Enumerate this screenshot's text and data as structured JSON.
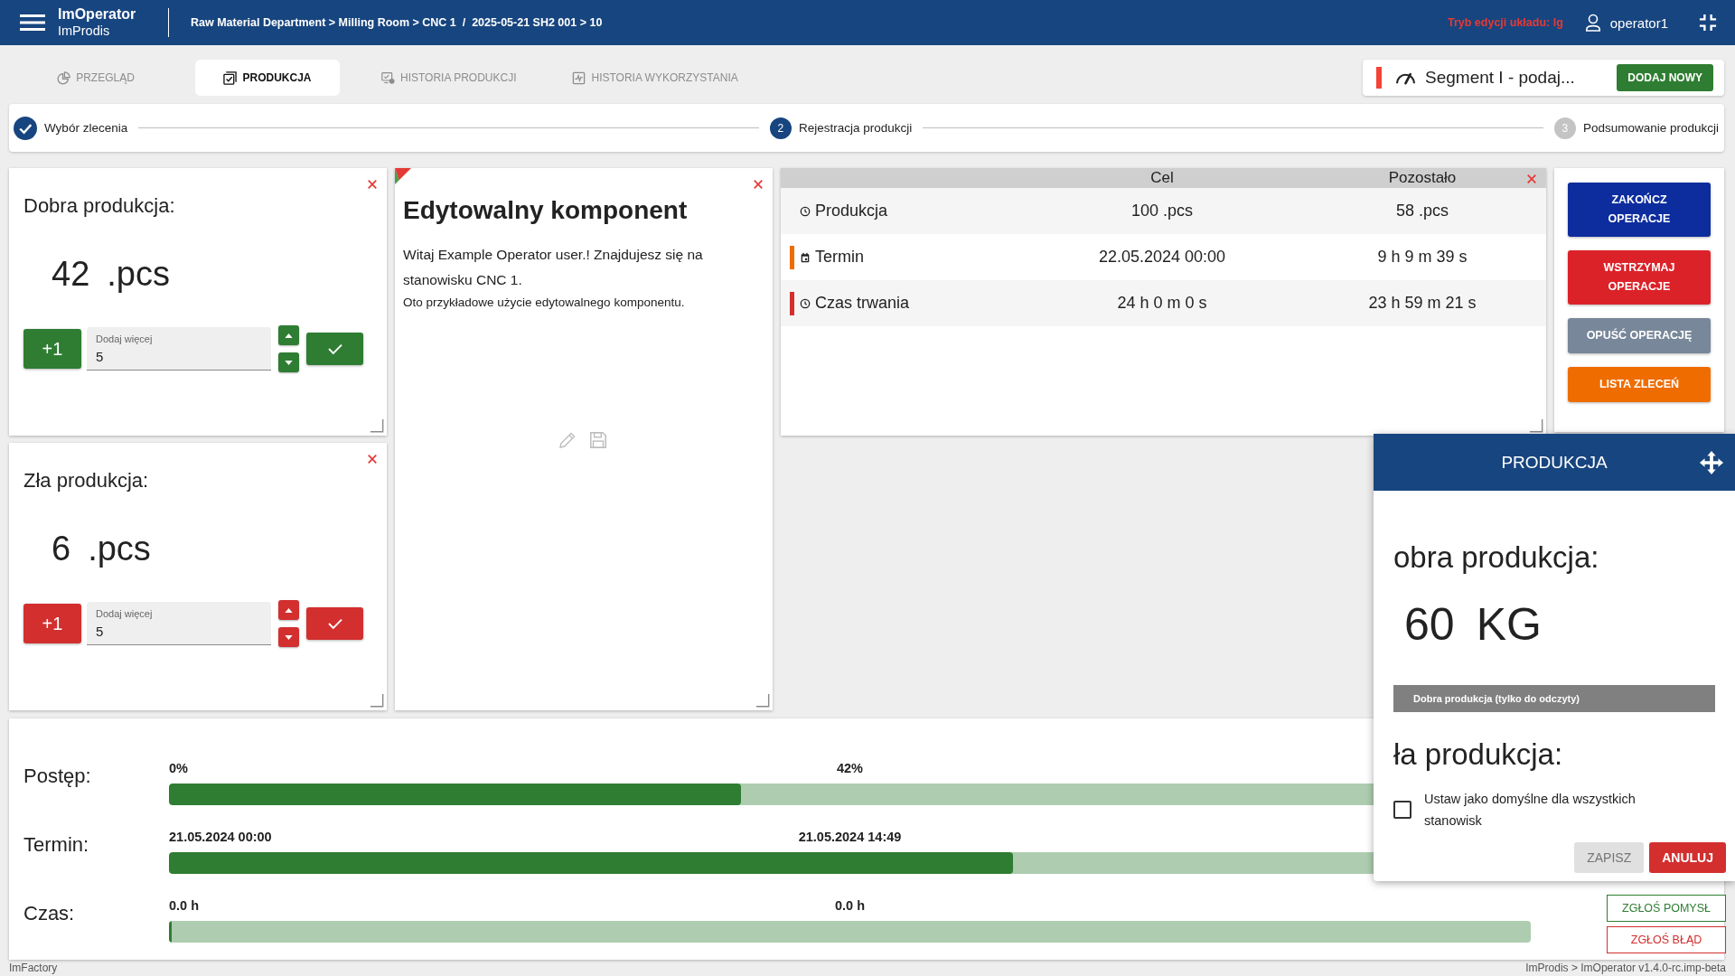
{
  "header": {
    "brand_title": "ImOperator",
    "brand_subtitle": "ImProdis",
    "breadcrumb": "Raw Material Department > Milling Room > CNC 1  /  2025-05-21 SH2 001 > 10",
    "edit_mode": "Tryb edycji układu: lg",
    "user": "operator1"
  },
  "tabs": [
    {
      "label": "PRZEGLĄD",
      "kind": "overview",
      "selected": false
    },
    {
      "label": "PRODUKCJA",
      "kind": "production",
      "selected": true
    },
    {
      "label": "HISTORIA PRODUKCJI",
      "kind": "history",
      "selected": false
    },
    {
      "label": "HISTORIA WYKORZYSTANIA",
      "kind": "usage",
      "selected": false
    }
  ],
  "segment": {
    "name": "Segment I - podaj...",
    "button": "DODAJ NOWY"
  },
  "stepper": [
    {
      "label": "Wybór zlecenia",
      "completed": true,
      "selected": false
    },
    {
      "number": "2",
      "label": "Rejestracja produkcji",
      "completed": false,
      "selected": true
    },
    {
      "number": "3",
      "label": "Podsumowanie produkcji",
      "completed": false,
      "selected": false
    }
  ],
  "counters": [
    {
      "title": "Dobra produkcja:",
      "value": "42",
      "unit": ".pcs",
      "color": "#2e7d32",
      "increment": "+1",
      "field": {
        "label": "Dodaj więcej",
        "value": "5"
      }
    },
    {
      "title": "Zła produkcja:",
      "value": "6",
      "unit": ".pcs",
      "color": "#d32f2f",
      "increment": "+1",
      "field": {
        "label": "Dodaj więcej",
        "value": "5"
      }
    }
  ],
  "editable": {
    "title": "Edytowalny komponent",
    "text": "Witaj Example Operator user.! Znajdujesz się na stanowisku CNC 1.",
    "note": "Oto przykładowe użycie edytowalnego komponentu."
  },
  "table": {
    "columns": [
      "Cel",
      "Pozostało"
    ],
    "rows": [
      {
        "label": "Produkcja",
        "kind": "quantity",
        "cells": [
          "100 .pcs",
          "58 .pcs"
        ]
      },
      {
        "label": "Termin",
        "kind": "deadline",
        "color": "#ef6c00",
        "cells": [
          "22.05.2024 00:00",
          "9 h 9 m 39 s"
        ]
      },
      {
        "label": "Czas trwania",
        "kind": "duration",
        "color": "#d32f2f",
        "cells": [
          "24 h 0 m 0 s",
          "23 h 59 m 21 s"
        ]
      }
    ]
  },
  "actions": [
    {
      "label": "ZAKOŃCZ OPERACJE",
      "color": "#0d2d9e"
    },
    {
      "label": "WSTRZYMAJ OPERACJE",
      "color": "#dc2229"
    },
    {
      "label": "OPUŚĆ OPERACJĘ",
      "color": "#78879a"
    },
    {
      "label": "LISTA ZLECEŃ",
      "color": "#ef6c00"
    }
  ],
  "progress": [
    {
      "label": "Postęp:",
      "start": "0%",
      "current": "42%",
      "level": 0.42
    },
    {
      "label": "Termin:",
      "start": "21.05.2024 00:00",
      "current": "21.05.2024 14:49",
      "level": 0.62
    },
    {
      "label": "Czas:",
      "start": "0.0 h",
      "current": "0.0 h",
      "level": 0
    }
  ],
  "dialog": {
    "title": "PRODUKCJA",
    "good_title": "obra produkcja:",
    "good_value": "60",
    "good_unit": "KG",
    "readonly_field": "Dobra produkcja (tylko do odczyty)",
    "bad_title": "ła produkcja:",
    "checkbox": {
      "label": "Ustaw jako domyślne dla wszystkich stanowisk",
      "checked": false
    },
    "buttons": [
      {
        "label": "ZAPISZ",
        "disabled": true
      },
      {
        "label": "ANULUJ",
        "disabled": false
      }
    ]
  },
  "feedback": [
    {
      "label": "ZGŁOŚ POMYSŁ",
      "color": "#2e7d32"
    },
    {
      "label": "ZGŁOŚ BŁĄD",
      "color": "#d32f2f"
    }
  ],
  "footer": {
    "left": "ImFactory",
    "right": "ImProdis > ImOperator v1.4.0-rc.imp-beta"
  }
}
